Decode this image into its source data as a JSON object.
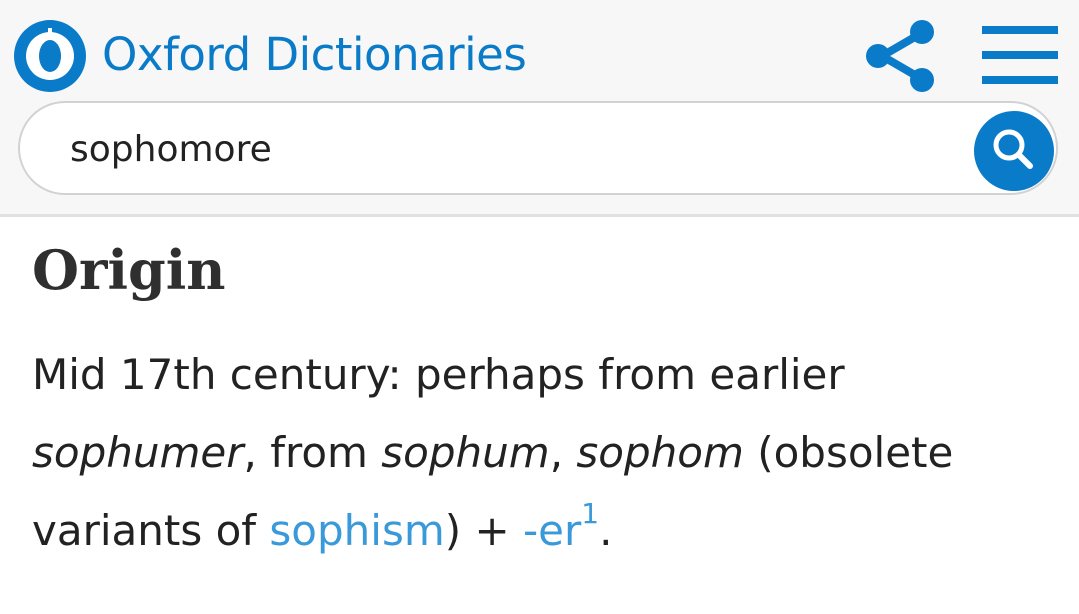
{
  "header": {
    "brand": "Oxford Dictionaries",
    "logo_icon": "oxford-logo-icon",
    "share_icon": "share-icon",
    "menu_icon": "hamburger-menu-icon",
    "accent_color": "#0a7bc9"
  },
  "search": {
    "value": "sophomore",
    "button_icon": "search-icon"
  },
  "entry": {
    "heading": "Origin",
    "line1": "Mid 17th century: perhaps from earlier",
    "term1": "sophumer",
    "text_from": ", from ",
    "term2": "sophum",
    "comma": ", ",
    "term3": "sophom",
    "text_obsolete": " (obsolete",
    "text_variants": "variants of ",
    "link_sophism": "sophism",
    "text_plus": ") + ",
    "link_er": "-er",
    "link_er_sup": "1",
    "period": ".",
    "link_color": "#3a9ad9"
  }
}
